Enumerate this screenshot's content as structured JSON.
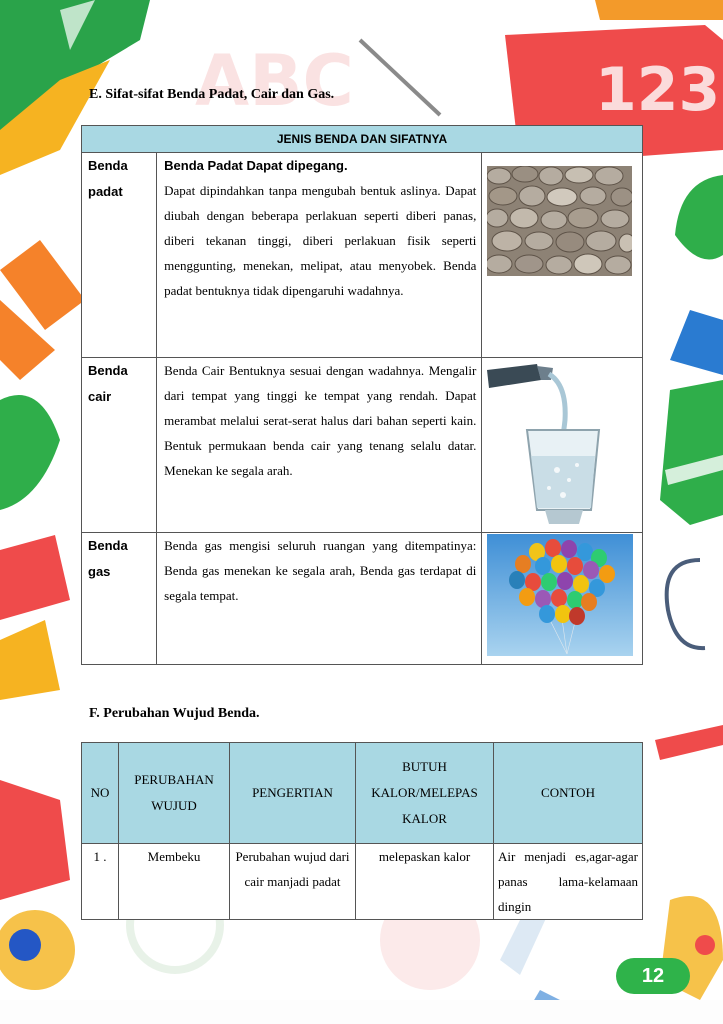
{
  "section_e": {
    "heading": "E. Sifat-sifat Benda Padat, Cair dan Gas.",
    "table_title": "JENIS BENDA DAN SIFATNYA",
    "rows": [
      {
        "name": "Benda padat",
        "lead": "Benda Padat Dapat dipegang.",
        "text": "Dapat dipindahkan tanpa mengubah bentuk aslinya. Dapat diubah dengan beberapa perlakuan seperti diberi panas, diberi tekanan tinggi, diberi perlakuan fisik seperti menggunting, menekan, melipat, atau menyobek. Benda padat bentuknya tidak dipengaruhi wadahnya.",
        "image": "pebbles-photo"
      },
      {
        "name": "Benda cair",
        "text": "Benda Cair Bentuknya sesuai dengan wadahnya. Mengalir dari tempat yang tinggi ke tempat yang rendah. Dapat merambat melalui serat-serat halus dari bahan seperti kain. Bentuk permukaan benda cair yang tenang selalu datar. Menekan ke segala arah.",
        "image": "water-glass-photo"
      },
      {
        "name": "Benda gas",
        "text": "Benda gas mengisi seluruh ruangan yang ditempatinya: Benda gas menekan ke segala arah, Benda gas terdapat di segala tempat.",
        "image": "balloons-photo"
      }
    ]
  },
  "section_f": {
    "heading": "F. Perubahan Wujud Benda.",
    "headers": [
      "NO",
      "PERUBAHAN WUJUD",
      "PENGERTIAN",
      "BUTUH KALOR/MELEPAS KALOR",
      "CONTOH"
    ],
    "rows": [
      [
        "1 .",
        "Membeku",
        "Perubahan wujud dari cair manjadi padat",
        "melepaskan kalor",
        "Air menjadi es,agar-agar panas lama-kelamaan dingin"
      ]
    ]
  },
  "page_number": "12"
}
